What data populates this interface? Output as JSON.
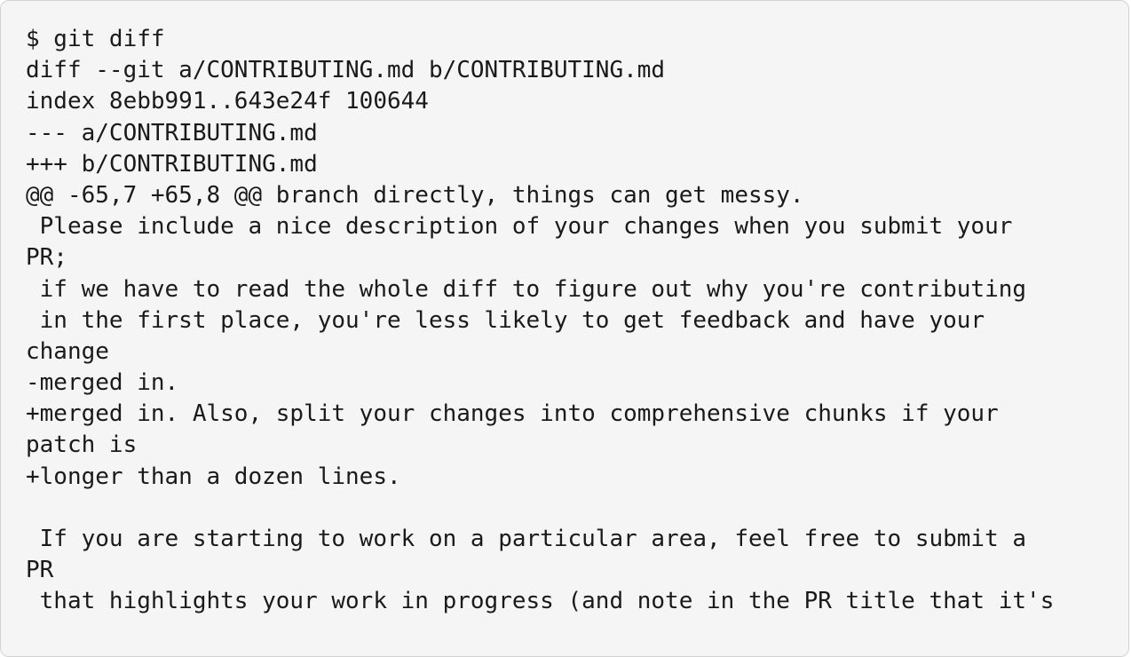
{
  "code_block": {
    "lines": [
      "$ git diff",
      "diff --git a/CONTRIBUTING.md b/CONTRIBUTING.md",
      "index 8ebb991..643e24f 100644",
      "--- a/CONTRIBUTING.md",
      "+++ b/CONTRIBUTING.md",
      "@@ -65,7 +65,8 @@ branch directly, things can get messy.",
      " Please include a nice description of your changes when you submit your",
      "PR;",
      " if we have to read the whole diff to figure out why you're contributing",
      " in the first place, you're less likely to get feedback and have your",
      "change",
      "-merged in.",
      "+merged in. Also, split your changes into comprehensive chunks if your",
      "patch is",
      "+longer than a dozen lines.",
      "",
      " If you are starting to work on a particular area, feel free to submit a",
      "PR",
      " that highlights your work in progress (and note in the PR title that it's"
    ]
  }
}
